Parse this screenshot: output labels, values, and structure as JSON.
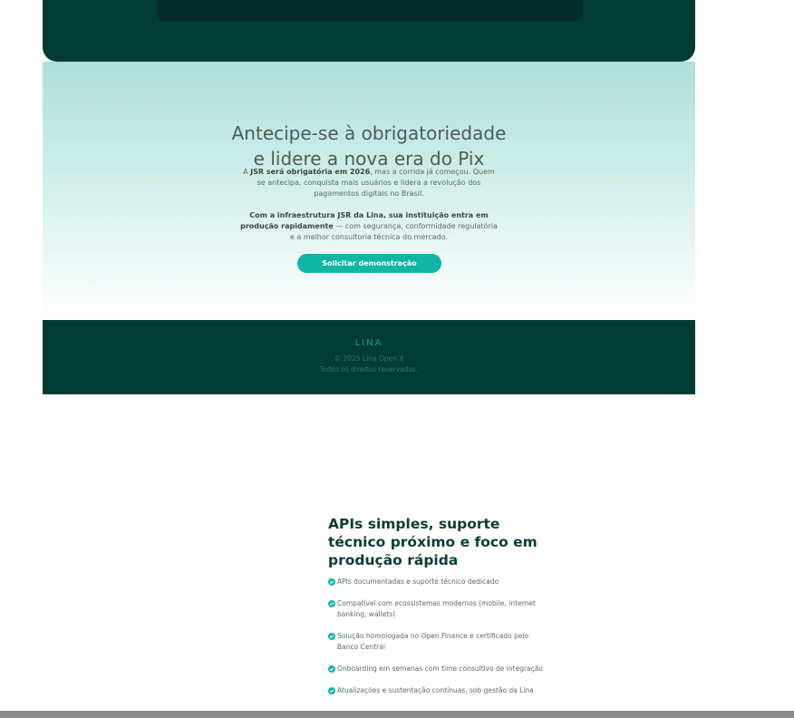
{
  "hero": {
    "title_line1": "Antecipe-se à obrigatoriedade",
    "title_line2": "e lidere a nova era do Pix",
    "p1_pre": "A ",
    "p1_bold": "JSR será obrigatória em 2026",
    "p1_post": ", mas a corrida já começou. Quem se antecipa, conquista mais usuários e lidera a revolução dos pagamentos digitais no Brasil.",
    "p2_bold": "Com a infraestrutura JSR da Lina, sua instituição entra em produção rapidamente",
    "p2_post": " — com segurança, conformidade regulatória e a melhor consultoria técnica do mercado.",
    "cta_label": "Solicitar demonstração"
  },
  "footer": {
    "logo": "LINA",
    "copyright": "© 2025 Lina Open X",
    "rights": "Todos os direitos reservados."
  },
  "features": {
    "title": "APIs simples, suporte técnico próximo e foco em produção rápida",
    "items": [
      "APIs documentadas e suporte técnico dedicado",
      "Compatível com ecossistemas modernos (mobile, internet banking, wallets)",
      "Solução homologada no Open Finance e certificado pelo Banco Central",
      "Onboarding em semanas com time consultivo de integração",
      "Atualizações e sustentação contínuas, sob gestão da Lina"
    ],
    "icon": "check-circle-icon",
    "icon_color": "#14b8a6"
  },
  "colors": {
    "dark": "#003b35",
    "accent": "#10b5a6"
  }
}
